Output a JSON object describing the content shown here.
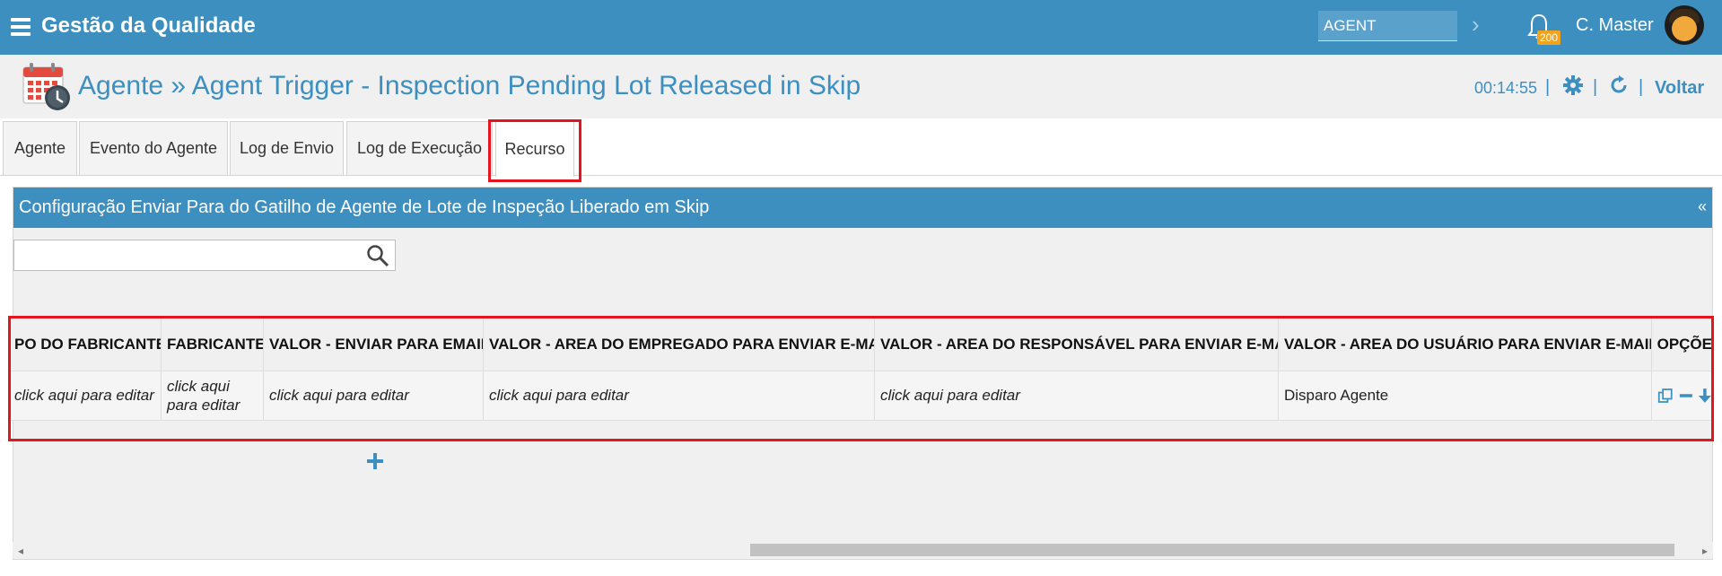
{
  "app": {
    "title": "Gestão da Qualidade"
  },
  "topbar": {
    "agent_value": "AGENT",
    "notification_count": "200",
    "user_name": "C. Master"
  },
  "page": {
    "title": "Agente » Agent Trigger - Inspection Pending Lot Released in Skip",
    "timer": "00:14:55",
    "voltar_label": "Voltar",
    "separator": "|"
  },
  "tabs": [
    {
      "label": "Agente"
    },
    {
      "label": "Evento do Agente"
    },
    {
      "label": "Log de Envio"
    },
    {
      "label": "Log de Execução"
    },
    {
      "label": "Recurso"
    }
  ],
  "panel": {
    "title": "Configuração Enviar Para do Gatilho de Agente de Lote de Inspeção Liberado em Skip",
    "collapse_label": "«"
  },
  "table": {
    "columns": [
      "PO DO FABRICANTE",
      "FABRICANTE",
      "VALOR - ENVIAR PARA EMAIL",
      "VALOR - AREA DO EMPREGADO PARA ENVIAR E-MAIL",
      "VALOR - AREA DO RESPONSÁVEL PARA ENVIAR E-MAIL",
      "VALOR - AREA DO USUÁRIO PARA ENVIAR E-MAIL",
      "OPÇÕE"
    ],
    "rows": [
      [
        "click aqui para editar",
        "click aqui para editar",
        "click aqui para editar",
        "click aqui para editar",
        "click aqui para editar",
        "Disparo Agente",
        ""
      ]
    ]
  },
  "colors": {
    "brand": "#3d8fc0",
    "highlight": "#e3161f",
    "badge": "#f2a31b"
  },
  "icons": [
    "menu-icon",
    "chevron-right-icon",
    "bell-icon",
    "calendar-clock-icon",
    "gear-icon",
    "refresh-icon",
    "search-icon",
    "copy-icon",
    "minus-icon",
    "arrow-down-icon",
    "plus-icon"
  ]
}
